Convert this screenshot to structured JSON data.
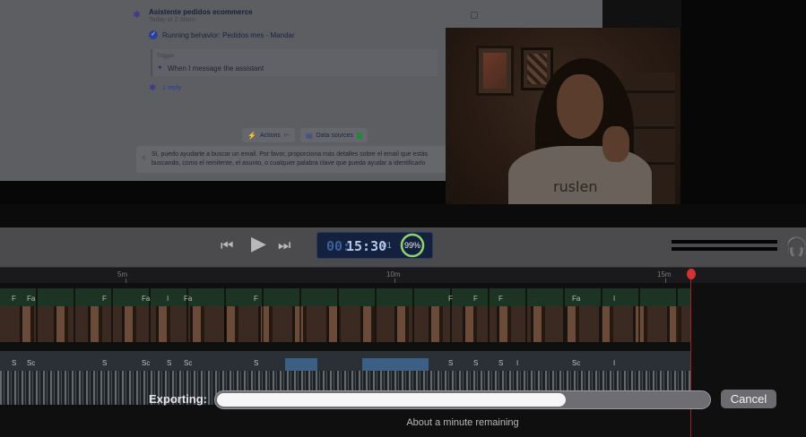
{
  "chat": {
    "title": "Asistente pedidos ecommerce",
    "time": "Today at 2:38am",
    "running": "Running behavior: Pedidos mes - Mandar",
    "trigger_label": "Trigger",
    "trigger_text": "When I message the assistant",
    "reply_link": "1 reply",
    "actions_label": "Actions",
    "data_sources_label": "Data sources",
    "answer_line1": "Sí, puedo ayudarte a buscar un email. Por favor, proporciona más detalles sobre el email que estás",
    "answer_line2": "buscando, como el remitente, el asunto, o cualquier palabra clave que pueda ayudar a identificarlo"
  },
  "webcam": {
    "shirt_text": "ruslen"
  },
  "transport": {
    "rewind_icon": "rewind-icon",
    "play_icon": "play-icon",
    "ffwd_icon": "fast-forward-icon",
    "timecode_hours": "00:",
    "timecode_main": "15:30",
    "timecode_frames": "01",
    "percent": "99%",
    "percent_value": 0.99,
    "headphones_icon": "headphones-icon"
  },
  "ruler": {
    "marks": [
      "5m",
      "10m",
      "15m"
    ]
  },
  "clip_labels": {
    "video": [
      "F",
      "Fa",
      "F",
      "Fa",
      "I",
      "Fa",
      "F",
      "F",
      "F",
      "F",
      "Fa",
      "I"
    ],
    "audio": [
      "S",
      "Sc",
      "S",
      "Sc",
      "S",
      "Sc",
      "S",
      "S",
      "S",
      "S",
      "I",
      "Sc",
      "I"
    ]
  },
  "export": {
    "label": "Exporting:",
    "progress": 0.71,
    "cancel_label": "Cancel",
    "remaining": "About a minute remaining"
  },
  "colors": {
    "playhead": "#d63232",
    "progress_fill": "#f6f6f7",
    "ring": "#8fd36b"
  }
}
